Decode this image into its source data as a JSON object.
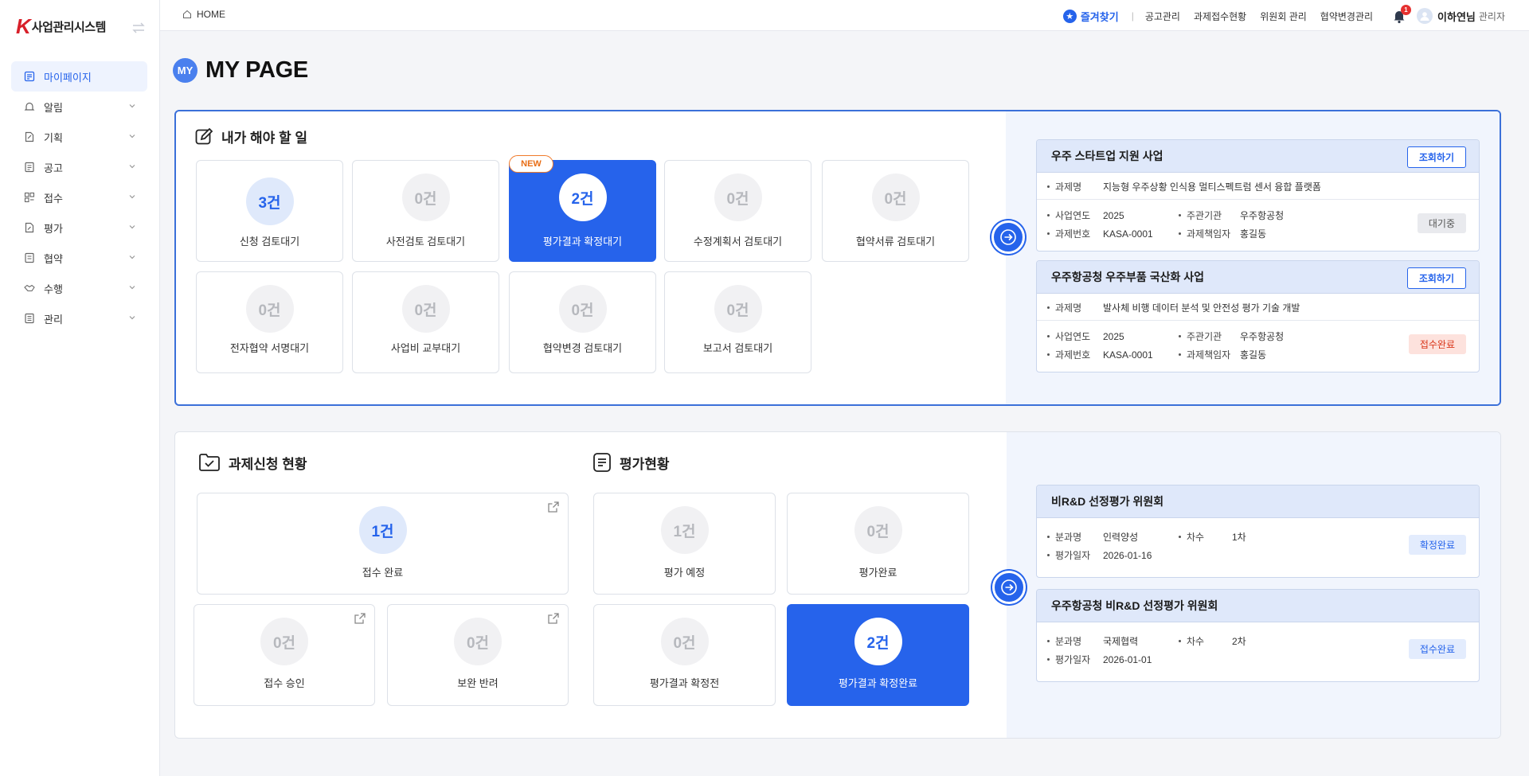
{
  "app": {
    "logo_letter": "K",
    "logo_text": "사업관리시스템"
  },
  "sidebar": {
    "items": [
      {
        "label": "마이페이지",
        "active": true
      },
      {
        "label": "알림"
      },
      {
        "label": "기획"
      },
      {
        "label": "공고"
      },
      {
        "label": "접수"
      },
      {
        "label": "평가"
      },
      {
        "label": "협약"
      },
      {
        "label": "수행"
      },
      {
        "label": "관리"
      }
    ]
  },
  "topbar": {
    "home_label": "HOME",
    "favorites_label": "즐겨찾기",
    "separator": "|",
    "links": [
      "공고관리",
      "과제접수현황",
      "위원회 관리",
      "협약변경관리"
    ],
    "notification_count": "1",
    "user_name": "이하연님",
    "user_role": "관리자"
  },
  "page": {
    "badge": "MY",
    "title": "MY PAGE"
  },
  "todo": {
    "title": "내가 해야 할 일",
    "new_badge": "NEW",
    "cards": [
      {
        "count": "3건",
        "label": "신청 검토대기"
      },
      {
        "count": "0건",
        "label": "사전검토 검토대기"
      },
      {
        "count": "2건",
        "label": "평가결과 확정대기"
      },
      {
        "count": "0건",
        "label": "수정계획서 검토대기"
      },
      {
        "count": "0건",
        "label": "협약서류 검토대기"
      },
      {
        "count": "0건",
        "label": "전자협약 서명대기"
      },
      {
        "count": "0건",
        "label": "사업비 교부대기"
      },
      {
        "count": "0건",
        "label": "협약변경 검토대기"
      },
      {
        "count": "0건",
        "label": "보고서 검토대기"
      }
    ]
  },
  "projects": [
    {
      "title": "우주 스타트업 지원 사업",
      "button": "조회하기",
      "task_name_label": "과제명",
      "task_name": "지능형 우주상황 인식용 멀티스펙트럼 센서 융합 플랫폼",
      "year_label": "사업연도",
      "year": "2025",
      "org_label": "주관기관",
      "org": "우주항공청",
      "no_label": "과제번호",
      "no": "KASA-0001",
      "manager_label": "과제책임자",
      "manager": "홍길동",
      "status": "대기중"
    },
    {
      "title": "우주항공청 우주부품 국산화 사업",
      "button": "조회하기",
      "task_name_label": "과제명",
      "task_name": "발사체 비행 데이터 분석 및 안전성 평가 기술 개발",
      "year_label": "사업연도",
      "year": "2025",
      "org_label": "주관기관",
      "org": "우주항공청",
      "no_label": "과제번호",
      "no": "KASA-0001",
      "manager_label": "과제책임자",
      "manager": "홍길동",
      "status": "접수완료"
    }
  ],
  "application": {
    "title": "과제신청 현황",
    "cards": [
      {
        "count": "1건",
        "label": "접수 완료"
      },
      {
        "count": "0건",
        "label": "접수 승인"
      },
      {
        "count": "0건",
        "label": "보완 반려"
      }
    ]
  },
  "evaluation": {
    "title": "평가현황",
    "cards": [
      {
        "count": "1건",
        "label": "평가 예정"
      },
      {
        "count": "0건",
        "label": "평가완료"
      },
      {
        "count": "0건",
        "label": "평가결과 확정전"
      },
      {
        "count": "2건",
        "label": "평가결과 확정완료"
      }
    ]
  },
  "committees": [
    {
      "title": "비R&D 선정평가 위원회",
      "field_label": "분과명",
      "field": "인력양성",
      "round_label": "차수",
      "round": "1차",
      "date_label": "평가일자",
      "date": "2026-01-16",
      "status": "확정완료"
    },
    {
      "title": "우주항공청 비R&D 선정평가 위원회",
      "field_label": "분과명",
      "field": "국제협력",
      "round_label": "차수",
      "round": "2차",
      "date_label": "평가일자",
      "date": "2026-01-01",
      "status": "접수완료"
    }
  ],
  "colors": {
    "accent": "#2563eb",
    "logo_red": "#d8202a",
    "new_orange": "#e86d15",
    "status_wait": "#e9eaee",
    "status_received": "#fde2dd",
    "status_confirmed": "#e3ecfd"
  }
}
